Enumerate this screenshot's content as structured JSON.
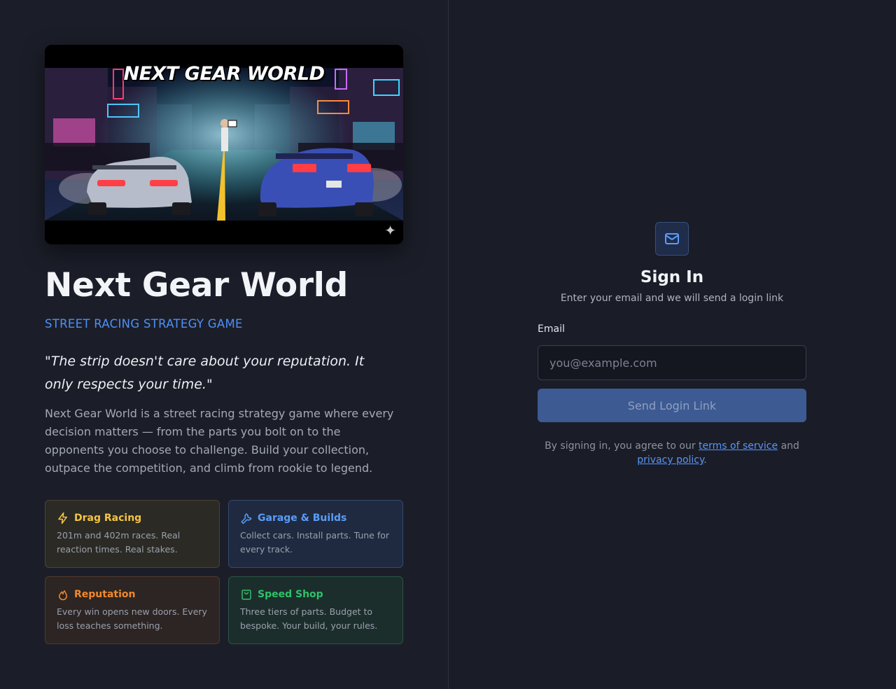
{
  "hero": {
    "image_title": "NEXT GEAR WORLD",
    "sparkle_icon": "sparkle-icon"
  },
  "brand": {
    "title": "Next Gear World",
    "subtitle": "STREET RACING STRATEGY GAME",
    "quote": "\"The strip doesn't care about your reputation. It only respects your time.\"",
    "description": "Next Gear World is a street racing strategy game where every decision matters — from the parts you bolt on to the opponents you choose to challenge. Build your collection, outpace the competition, and climb from rookie to legend."
  },
  "features": [
    {
      "title": "Drag Racing",
      "text": "201m and 402m races. Real reaction times. Real stakes.",
      "icon": "lightning-icon",
      "color": "#f5c542"
    },
    {
      "title": "Garage & Builds",
      "text": "Collect cars. Install parts. Tune for every track.",
      "icon": "wrench-icon",
      "color": "#5b9cf7"
    },
    {
      "title": "Reputation",
      "text": "Every win opens new doors. Every loss teaches something.",
      "icon": "flame-icon",
      "color": "#f2892e"
    },
    {
      "title": "Speed Shop",
      "text": "Three tiers of parts. Budget to bespoke. Your build, your rules.",
      "icon": "shopping-bag-icon",
      "color": "#2fc16a"
    }
  ],
  "signin": {
    "icon": "mail-icon",
    "title": "Sign In",
    "subtitle": "Enter your email and we will send a login link",
    "email_label": "Email",
    "email_placeholder": "you@example.com",
    "email_value": "",
    "button_label": "Send Login Link",
    "terms_prefix": "By signing in, you agree to our",
    "terms_link": "terms of service",
    "terms_and": "and",
    "privacy_link": "privacy policy",
    "terms_suffix": "."
  },
  "colors": {
    "accent": "#4f8ff7",
    "background": "#1a1d27",
    "button": "#3d5a92"
  }
}
